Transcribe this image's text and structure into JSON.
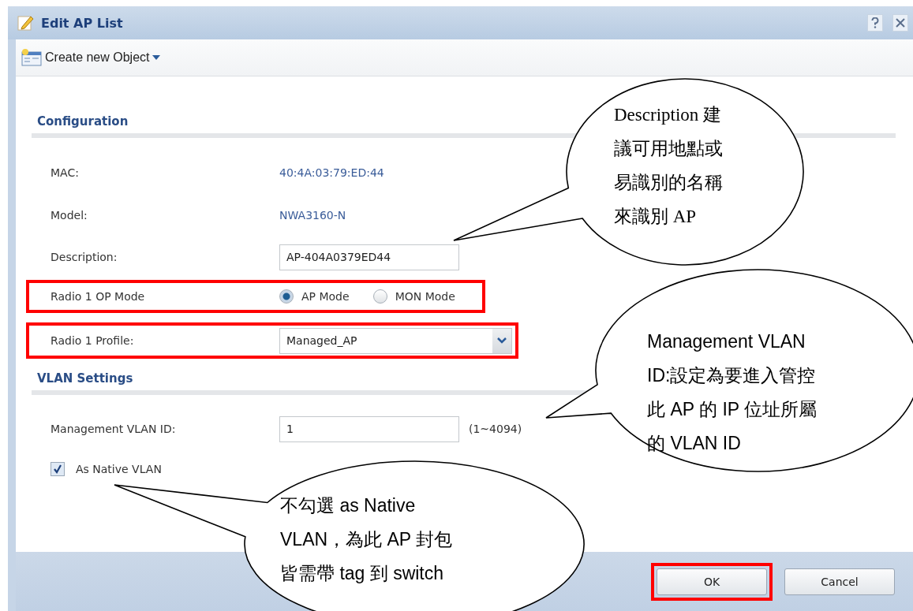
{
  "window": {
    "title": "Edit AP List"
  },
  "toolbar": {
    "menu": "Create new Object"
  },
  "sections": [
    {
      "title": "Configuration",
      "fields": [
        {
          "kind": "info",
          "label": "MAC:",
          "value": "40:4A:03:79:ED:44",
          "highlighted": false
        },
        {
          "kind": "info",
          "label": "Model:",
          "value": "NWA3160-N",
          "highlighted": false
        },
        {
          "kind": "text",
          "label": "Description:",
          "value": "AP-404A0379ED44",
          "highlighted": false
        },
        {
          "kind": "radio",
          "label": "Radio 1 OP Mode",
          "options": [
            {
              "label": "AP Mode",
              "selected": true
            },
            {
              "label": "MON Mode",
              "selected": false
            }
          ],
          "highlighted": true
        },
        {
          "kind": "select",
          "label": "Radio 1 Profile:",
          "value": "Managed_AP",
          "highlighted": true
        }
      ]
    },
    {
      "title": "VLAN Settings",
      "fields": [
        {
          "kind": "text",
          "label": "Management VLAN ID:",
          "value": "1",
          "note": "(1~4094)",
          "highlighted": false
        },
        {
          "kind": "checkbox",
          "label": "As Native VLAN",
          "checked": true,
          "highlighted": false
        }
      ]
    }
  ],
  "buttons": [
    {
      "label": "OK",
      "highlighted": true
    },
    {
      "label": "Cancel",
      "highlighted": false
    }
  ],
  "callouts": [
    {
      "lines": [
        "Description 建",
        "議可用地點或",
        "易識別的名稱",
        "來識別 AP"
      ]
    },
    {
      "lines": [
        "Management VLAN",
        "ID:設定為要進入管控",
        "此 AP 的 IP 位址所屬",
        "的 VLAN ID"
      ]
    },
    {
      "lines": [
        "不勾選 as Native",
        "VLAN，為此 AP 封包",
        "皆需帶 tag 到 switch"
      ]
    }
  ]
}
